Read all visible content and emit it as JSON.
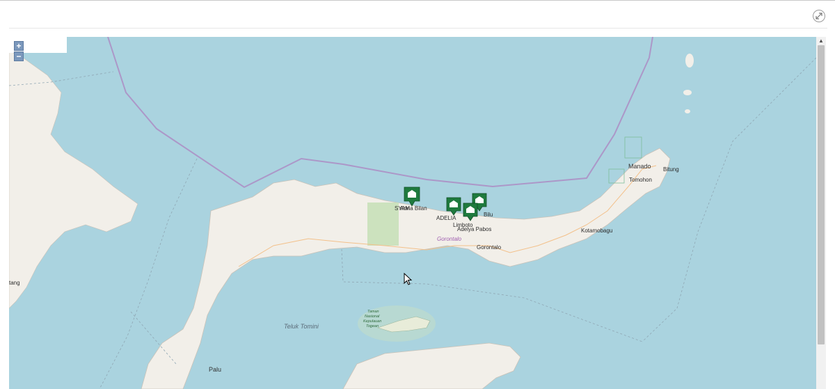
{
  "toolbar": {
    "expand_icon": "expand-arrows-icon"
  },
  "map": {
    "zoom_in_label": "+",
    "zoom_out_label": "−",
    "colors": {
      "water": "#aad3df",
      "land": "#f2efe9",
      "boundary": "#ac97c8",
      "park": "#c8e0b9",
      "marker": "#1f7a3e"
    },
    "places": {
      "manado": "Manado",
      "bitung": "Bitung",
      "tomohon": "Tomohon",
      "kotamobagu": "Kotamobagu",
      "gorontalo_city": "Gorontalo",
      "gorontalo_province": "Gorontalo",
      "teluk_tomini": "Teluk Tomini",
      "palu": "Palu",
      "tang": "tang",
      "syam": "SYAM",
      "adelia": "ADELIA",
      "adelia2": "Adelya Pabos",
      "marker_text_1": "Arina Bilan",
      "marker_text_2": "Bilu",
      "marker_text_3": "Limboto",
      "park_line1": "Taman",
      "park_line2": "Nasional",
      "park_line3": "Kepulauan",
      "park_line4": "Togean"
    },
    "markers": [
      {
        "name": "site-1",
        "icon": "building-icon"
      },
      {
        "name": "site-2",
        "icon": "building-icon"
      },
      {
        "name": "site-3",
        "icon": "building-icon"
      },
      {
        "name": "site-4",
        "icon": "building-icon"
      }
    ]
  }
}
